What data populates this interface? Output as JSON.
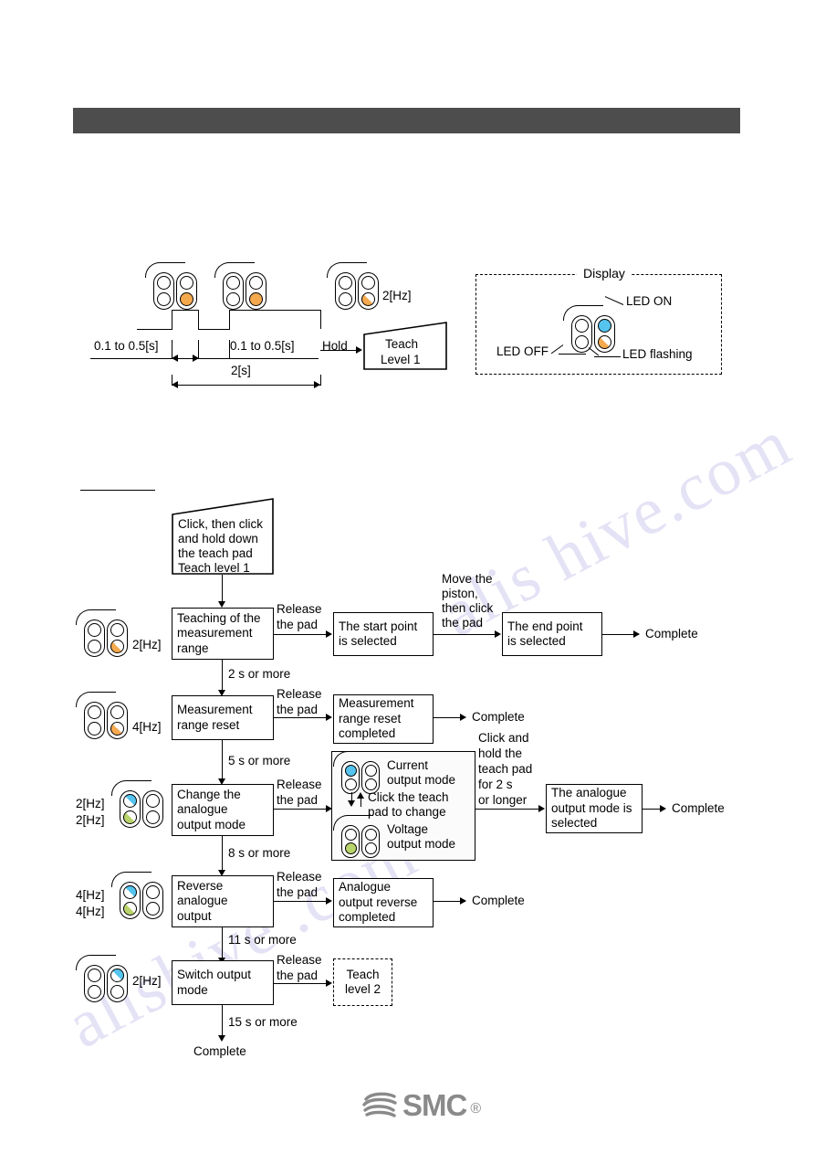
{
  "document": {
    "type": "technical-manual-page",
    "header_bar_color": "#4d4d4d",
    "footer_logo": "SMC",
    "footer_logo_mark": "smc-swoosh-icon"
  },
  "timing_diagram": {
    "name": "teach-level-1-timing-diagram",
    "pulse_label_left": "0.1 to 0.5[s]",
    "pulse_label_right": "0.1 to 0.5[s]",
    "total_label": "2[s]",
    "hold_label": "Hold",
    "freq_label": "2[Hz]",
    "result_box_line1": "Teach",
    "result_box_line2": "Level 1",
    "leds": [
      {
        "name": "led-indicator-pulse-1",
        "left_top": "off",
        "left_bottom": "off",
        "right_top": "off",
        "right_bottom": "on-orange"
      },
      {
        "name": "led-indicator-pulse-2",
        "left_top": "off",
        "left_bottom": "off",
        "right_top": "off",
        "right_bottom": "on-orange"
      },
      {
        "name": "led-indicator-hold",
        "left_top": "off",
        "left_bottom": "off",
        "right_top": "off",
        "right_bottom": "flash-orange"
      }
    ]
  },
  "legend": {
    "title": "Display",
    "led_on": "LED ON",
    "led_off": "LED OFF",
    "led_flashing": "LED flashing",
    "colors": {
      "on": "#55c4ee",
      "flashing": "#f5a94e"
    }
  },
  "flowchart": {
    "start_box": {
      "name": "start-trapezoid",
      "lines": [
        "Click, then click",
        "and hold down",
        "the teach pad",
        "Teach level 1"
      ]
    },
    "rows": [
      {
        "name": "row-teaching-measurement-range",
        "hz": [
          "2[Hz]"
        ],
        "led": {
          "left_top": "off",
          "left_bottom": "off",
          "right_top": "off",
          "right_bottom": "flash-orange"
        },
        "main_box": [
          "Teaching of the",
          "measurement",
          "range"
        ],
        "edge_label": [
          "Release",
          "the pad"
        ],
        "result_box": [
          "The start point",
          "is selected"
        ],
        "second_edge_label": [
          "Move the",
          "piston,",
          "then click",
          "the pad"
        ],
        "second_box": [
          "The end point",
          "is selected"
        ],
        "terminal": "Complete",
        "down_label": "2 s or more"
      },
      {
        "name": "row-measurement-range-reset",
        "hz": [
          "4[Hz]"
        ],
        "led": {
          "left_top": "off",
          "left_bottom": "off",
          "right_top": "off",
          "right_bottom": "flash-orange"
        },
        "main_box": [
          "Measurement",
          "range reset"
        ],
        "edge_label": [
          "Release",
          "the pad"
        ],
        "result_box": [
          "Measurement",
          "range reset",
          "completed"
        ],
        "terminal": "Complete",
        "down_label": "5 s or more"
      },
      {
        "name": "row-change-analogue-output-mode",
        "hz": [
          "2[Hz]",
          "2[Hz]"
        ],
        "led": {
          "left_top": "flash-blue",
          "left_bottom": "flash-green",
          "right_top": "off",
          "right_bottom": "off"
        },
        "main_box": [
          "Change the",
          "analogue",
          "output mode"
        ],
        "edge_label": [
          "Release",
          "the pad"
        ],
        "mode_panel": {
          "current_mode": [
            "Current",
            "output mode"
          ],
          "current_led": {
            "left_top": "on-blue",
            "left_bottom": "off",
            "right_top": "off",
            "right_bottom": "off"
          },
          "change_hint": [
            "Click the teach",
            "pad to change"
          ],
          "voltage_mode": [
            "Voltage",
            "output mode"
          ],
          "voltage_led": {
            "left_top": "off",
            "left_bottom": "on-green",
            "right_top": "off",
            "right_bottom": "off"
          }
        },
        "second_edge_label": [
          "Click and",
          "hold the",
          "teach pad",
          "for 2 s",
          "or longer"
        ],
        "second_box": [
          "The analogue",
          "output mode is",
          "selected"
        ],
        "terminal": "Complete",
        "down_label": "8 s or more"
      },
      {
        "name": "row-reverse-analogue-output",
        "hz": [
          "4[Hz]",
          "4[Hz]"
        ],
        "led": {
          "left_top": "flash-blue",
          "left_bottom": "flash-green",
          "right_top": "off",
          "right_bottom": "off"
        },
        "main_box": [
          "Reverse",
          "analogue",
          "output"
        ],
        "edge_label": [
          "Release",
          "the pad"
        ],
        "result_box": [
          "Analogue",
          "output reverse",
          "completed"
        ],
        "terminal": "Complete",
        "down_label": "11 s or more"
      },
      {
        "name": "row-switch-output-mode",
        "hz": [
          "2[Hz]"
        ],
        "led": {
          "left_top": "off",
          "left_bottom": "off",
          "right_top": "flash-blue",
          "right_bottom": "off"
        },
        "main_box": [
          "Switch output",
          "mode"
        ],
        "edge_label": [
          "Release",
          "the pad"
        ],
        "result_box": [
          "Teach",
          "level 2"
        ],
        "result_box_dashed": true,
        "down_label": "15 s or more"
      }
    ],
    "final_terminal": "Complete"
  },
  "watermarks": [
    "alis hive.com",
    "alishive .com"
  ]
}
